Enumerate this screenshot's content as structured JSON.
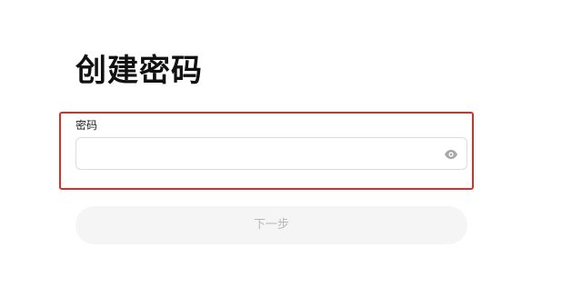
{
  "page": {
    "title": "创建密码"
  },
  "password": {
    "label": "密码",
    "value": "",
    "placeholder": ""
  },
  "actions": {
    "next_label": "下一步"
  },
  "colors": {
    "highlight": "#d93025",
    "button_bg": "#f5f5f5",
    "button_text": "#b8b8b8"
  },
  "icons": {
    "visibility": "eye-icon"
  }
}
